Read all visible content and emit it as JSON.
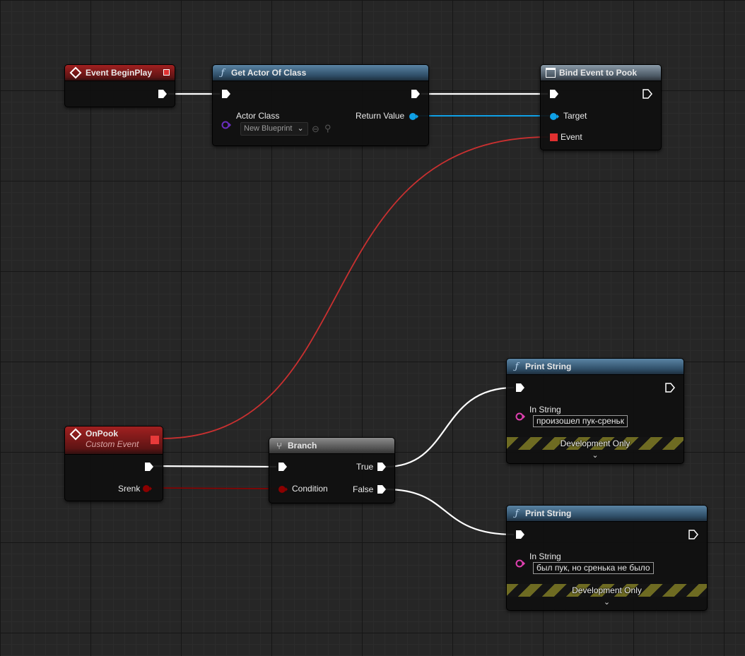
{
  "colors": {
    "exec_wire": "#ffffff",
    "object_wire": "#0fa0e6",
    "delegate_wire": "#d03030",
    "bool_wire": "#8c0000",
    "string_pin": "#e040b0",
    "class_pin": "#6a2ec0"
  },
  "nodes": {
    "begin_play": {
      "title": "Event BeginPlay"
    },
    "get_actor": {
      "title": "Get Actor Of Class",
      "actor_class_label": "Actor Class",
      "actor_class_value": "New Blueprint",
      "return_value_label": "Return Value"
    },
    "bind_event": {
      "title": "Bind Event to Pook",
      "target_label": "Target",
      "event_label": "Event"
    },
    "on_pook": {
      "title": "OnPook",
      "subtitle": "Custom Event",
      "param_label": "Srenk"
    },
    "branch": {
      "title": "Branch",
      "condition_label": "Condition",
      "true_label": "True",
      "false_label": "False"
    },
    "print_1": {
      "title": "Print String",
      "in_string_label": "In String",
      "in_string_value": "произошел пук-среньк",
      "dev_only": "Development Only"
    },
    "print_2": {
      "title": "Print String",
      "in_string_label": "In String",
      "in_string_value": "был пук, но сренька не было",
      "dev_only": "Development Only"
    }
  }
}
